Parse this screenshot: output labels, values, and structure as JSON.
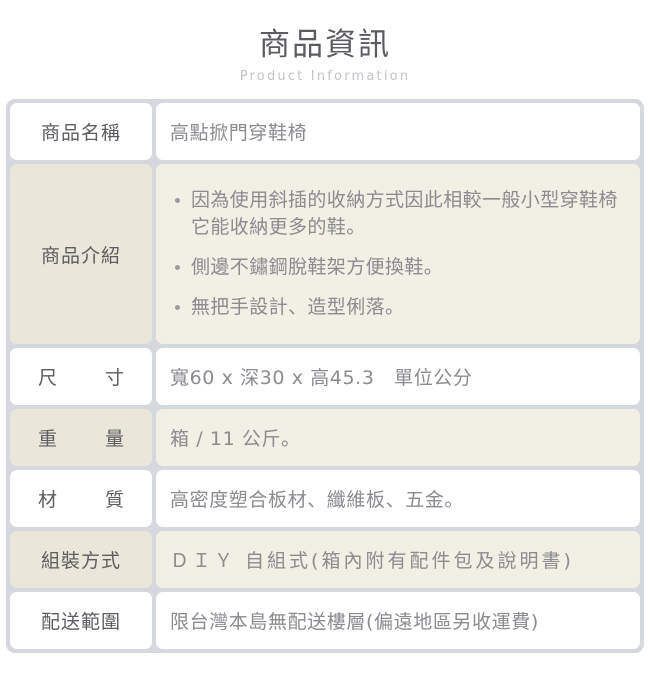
{
  "header": {
    "title": "商品資訊",
    "subtitle": "Product Information"
  },
  "colors": {
    "grid_background": "#d5d9df",
    "row_light": "#ffffff",
    "row_tint_label": "#eae6d9",
    "row_tint_value": "#f2efe5",
    "label_text": "#5d5d62",
    "value_text": "#8b8b90",
    "title_text": "#5b5b60",
    "subtitle_text": "#c3c3c8",
    "bullet_marker": "#9a9a9f"
  },
  "table": {
    "rows": [
      {
        "label": "商品名稱",
        "value": "高點掀門穿鞋椅"
      },
      {
        "label": "商品介紹",
        "bullets": [
          "因為使用斜插的收納方式因此相較一般小型穿鞋椅它能收納更多的鞋。",
          "側邊不鏽鋼脫鞋架方便換鞋。",
          "無把手設計、造型俐落。"
        ]
      },
      {
        "label_char_1": "尺",
        "label_char_2": "寸",
        "label": "尺 寸",
        "value": "寬60 x 深30 x 高45.3　單位公分"
      },
      {
        "label_char_1": "重",
        "label_char_2": "量",
        "label": "重 量",
        "value": "箱 / 11 公斤。"
      },
      {
        "label_char_1": "材",
        "label_char_2": "質",
        "label": "材 質",
        "value": "高密度塑合板材、纖維板、五金。"
      },
      {
        "label": "組裝方式",
        "value": "ＤＩＹ 自組式(箱內附有配件包及說明書)"
      },
      {
        "label": "配送範圍",
        "value": "限台灣本島無配送樓層(偏遠地區另收運費)"
      }
    ]
  }
}
